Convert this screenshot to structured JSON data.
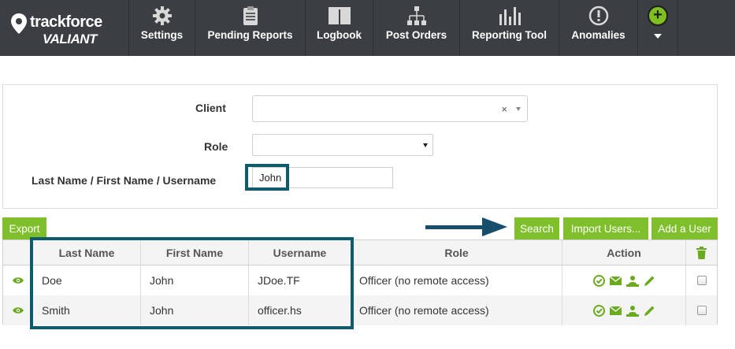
{
  "brand": {
    "line1": "trackforce",
    "line2": "VALIANT"
  },
  "nav": {
    "items": [
      {
        "label": "Settings",
        "icon": "gear-icon"
      },
      {
        "label": "Pending Reports",
        "icon": "clipboard-icon"
      },
      {
        "label": "Logbook",
        "icon": "book-icon"
      },
      {
        "label": "Post Orders",
        "icon": "org-chart-icon"
      },
      {
        "label": "Reporting Tool",
        "icon": "bar-chart-icon"
      },
      {
        "label": "Anomalies",
        "icon": "alert-circle-icon"
      }
    ],
    "plus_label": "+"
  },
  "filters": {
    "client_label": "Client",
    "client_value": "",
    "client_clear": "×",
    "role_label": "Role",
    "role_value": "",
    "name_label": "Last Name / First Name / Username",
    "name_value": "John"
  },
  "toolbar": {
    "export_label": "Export",
    "search_label": "Search",
    "import_label": "Import Users...",
    "add_label": "Add a User"
  },
  "table": {
    "columns": [
      "Last Name",
      "First Name",
      "Username",
      "Role",
      "Action"
    ],
    "rows": [
      {
        "last": "Doe",
        "first": "John",
        "username": "JDoe.TF",
        "role": "Officer (no remote access)"
      },
      {
        "last": "Smith",
        "first": "John",
        "username": "officer.hs",
        "role": "Officer (no remote access)"
      }
    ]
  },
  "colors": {
    "nav_bg": "#3b3e43",
    "accent_green": "#7fbf2b",
    "highlight": "#0d5b6b"
  }
}
